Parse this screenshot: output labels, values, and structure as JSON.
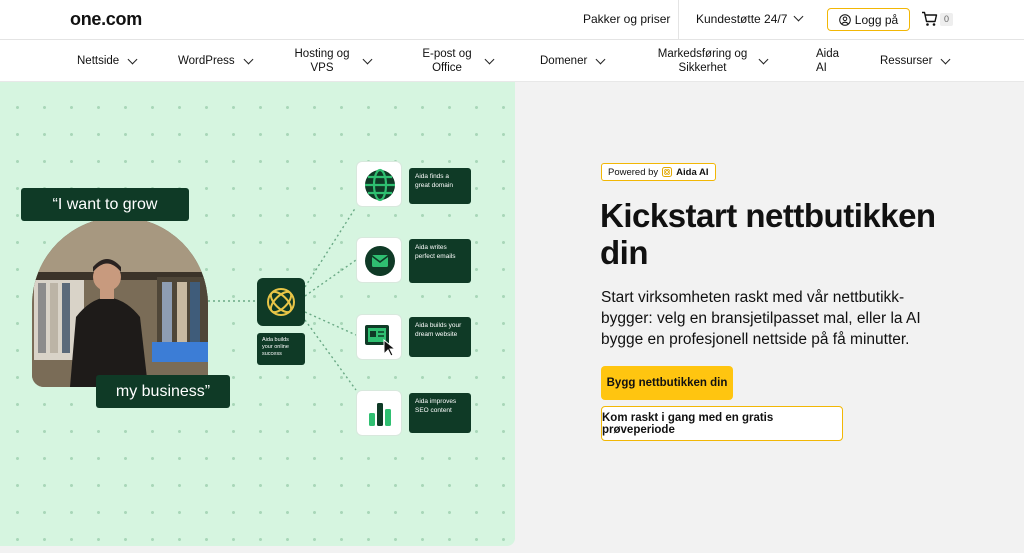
{
  "topbar": {
    "logo": "one.com",
    "packages_link": "Pakker og priser",
    "support_link": "Kundestøtte 24/7",
    "login_label": "Logg på",
    "cart_count": "0"
  },
  "nav": {
    "items": [
      {
        "label": "Nettside"
      },
      {
        "label": "WordPress"
      },
      {
        "label": "Hosting og VPS"
      },
      {
        "label": "E-post og Office"
      },
      {
        "label": "Domener"
      },
      {
        "label": "Markedsføring og Sikkerhet"
      },
      {
        "label": "Aida AI"
      },
      {
        "label": "Ressurser"
      }
    ]
  },
  "illustration": {
    "quote_top": "“I want to grow",
    "quote_bottom": "my business”",
    "center_caption": "Aida builds your online success",
    "tiles": [
      {
        "label": "Aida finds a great domain",
        "icon": "globe-icon"
      },
      {
        "label": "Aida writes perfect emails",
        "icon": "email-icon"
      },
      {
        "label": "Aida builds your dream website",
        "icon": "website-icon"
      },
      {
        "label": "Aida improves SEO content",
        "icon": "bar-chart-icon"
      }
    ],
    "colors": {
      "dark_green": "#0f3a26",
      "mint": "#d6f5e0",
      "accent_green": "#2fbf71",
      "gold": "#f2b705"
    }
  },
  "hero": {
    "powered_by": "Powered by",
    "aida_brand": "Aida AI",
    "headline": "Kickstart nettbutikken din",
    "subtext": "Start virksomheten raskt med vår nettbutikk-bygger: velg en bransjetilpasset mal, eller la AI bygge en profesjonell nettside på få minutter.",
    "cta_primary": "Bygg nettbutikken din",
    "cta_secondary": "Kom raskt i gang med en gratis prøveperiode",
    "colors": {
      "cta_yellow": "#ffc510"
    }
  }
}
